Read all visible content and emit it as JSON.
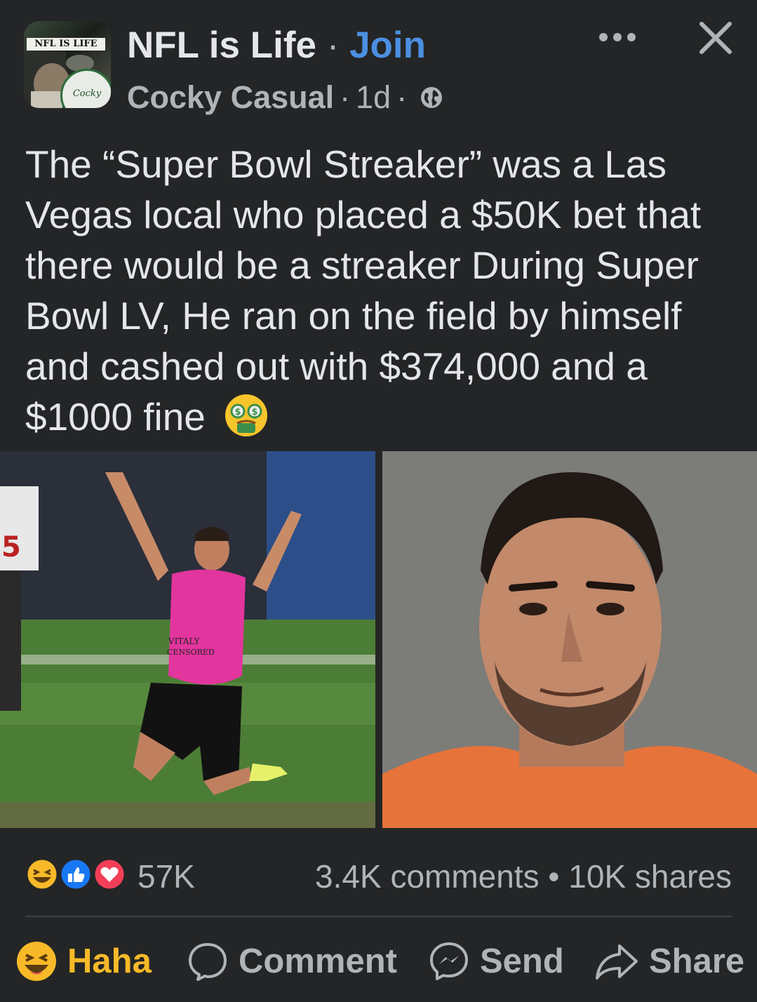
{
  "header": {
    "avatar_top_text": "NFL IS LIFE",
    "avatar_badge_text": "Cocky Casual",
    "group_name": "NFL is Life",
    "separator": "·",
    "join_label": "Join",
    "author": "Cocky Casual",
    "timestamp": "1d",
    "privacy_icon": "globe-icon",
    "more_icon": "more-dots-icon",
    "close_icon": "close-icon"
  },
  "post": {
    "text": "The “Super Bowl Streaker” was a Las Vegas local who placed a $50K bet that there would be a streaker During Super Bowl LV, He ran on the field by himself and cashed out with $374,000 and a $1000 fine",
    "emoji": "money-mouth-face-emoji",
    "image_left_jersey_text": "VITALY\nCENSORED",
    "image_left_number": "5"
  },
  "engagement": {
    "reaction_icons": [
      "haha-icon",
      "like-icon",
      "love-icon"
    ],
    "reaction_count": "57K",
    "comments": "3.4K comments",
    "dot": "•",
    "shares": "10K shares"
  },
  "actions": {
    "haha_label": "Haha",
    "comment_label": "Comment",
    "send_label": "Send",
    "share_label": "Share"
  },
  "colors": {
    "background": "#242526",
    "text_primary": "#e4e6eb",
    "text_secondary": "#b0b3b8",
    "join_blue": "#4b8fe0",
    "haha_yellow": "#f7b928",
    "love_red": "#f33e58",
    "like_blue": "#1877f2"
  }
}
